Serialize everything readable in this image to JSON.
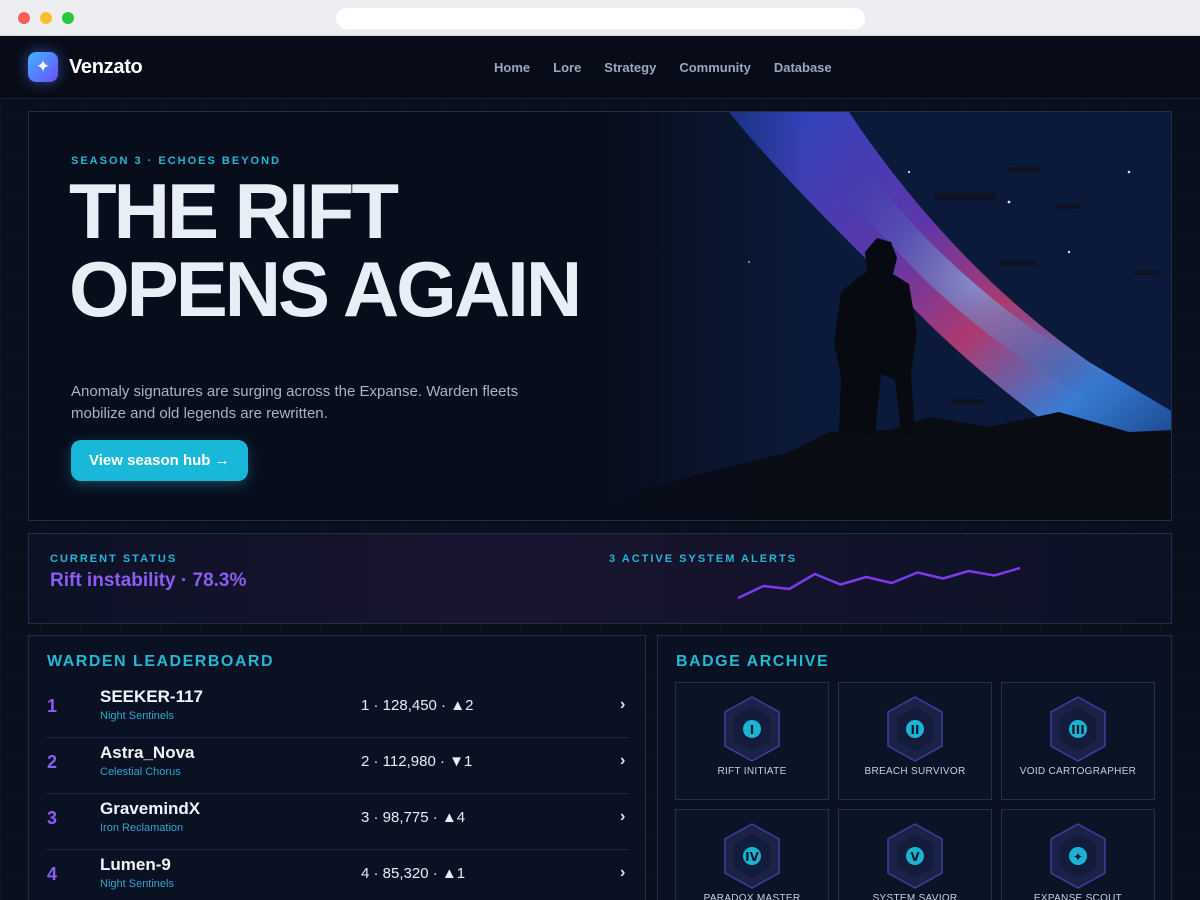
{
  "brand": {
    "name": "Venzato",
    "logo_icon": "sparkle-icon"
  },
  "nav": {
    "links": [
      "Home",
      "Lore",
      "Strategy",
      "Community",
      "Database"
    ]
  },
  "hero": {
    "eyebrow": "SEASON 3 · ECHOES BEYOND",
    "title_line1": "THE RIFT",
    "title_line2": "OPENS AGAIN",
    "description": "Anomaly signatures are surging across the Expanse. Warden fleets mobilize and old legends are rewritten.",
    "cta_label": "View season hub →"
  },
  "status": {
    "label": "CURRENT STATUS",
    "value": "Rift instability · 78.3%",
    "alerts_label": "3 ACTIVE SYSTEM ALERTS",
    "sparkline": [
      0,
      8,
      6,
      16,
      9,
      14,
      10,
      17,
      13,
      18,
      15,
      20
    ]
  },
  "leaderboard": {
    "title": "WARDEN LEADERBOARD",
    "rows": [
      {
        "rank": "1",
        "name": "SEEKER-117",
        "team": "Night Sentinels",
        "stats": "1 · 128,450 · ▲2"
      },
      {
        "rank": "2",
        "name": "Astra_Nova",
        "team": "Celestial Chorus",
        "stats": "2 · 112,980 · ▼1"
      },
      {
        "rank": "3",
        "name": "GravemindX",
        "team": "Iron Reclamation",
        "stats": "3 · 98,775 · ▲4"
      },
      {
        "rank": "4",
        "name": "Lumen-9",
        "team": "Night Sentinels",
        "stats": "4 · 85,320 · ▲1"
      }
    ]
  },
  "badges": {
    "title": "BADGE ARCHIVE",
    "items": [
      {
        "label": "RIFT INITIATE",
        "glyph": "I"
      },
      {
        "label": "BREACH SURVIVOR",
        "glyph": "II"
      },
      {
        "label": "VOID CARTOGRAPHER",
        "glyph": "III"
      },
      {
        "label": "PARADOX MASTER",
        "glyph": "IV"
      },
      {
        "label": "SYSTEM SAVIOR",
        "glyph": "V"
      },
      {
        "label": "EXPANSE SCOUT",
        "glyph": "✦"
      }
    ]
  },
  "colors": {
    "accent_cyan": "#22b8d6",
    "accent_purple": "#8b5cf6",
    "background": "#0a0f1e",
    "cta": "#1ab8d8"
  }
}
